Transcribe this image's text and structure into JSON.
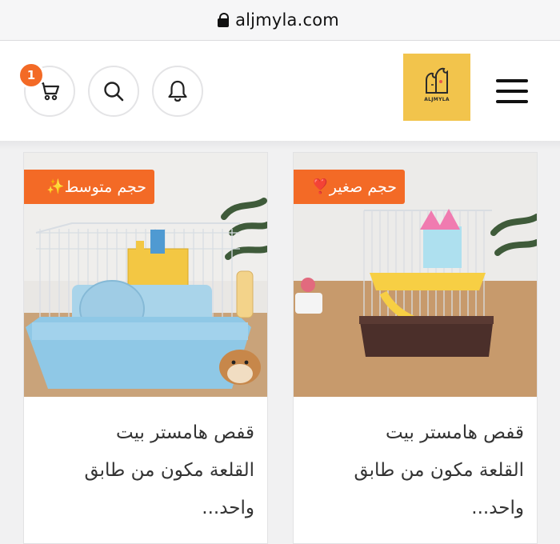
{
  "browser": {
    "url": "aljmyla.com"
  },
  "header": {
    "cart_count": "1",
    "logo_text": "ALJMYLA"
  },
  "products": [
    {
      "badge_label": "حجم متوسط",
      "badge_emoji": "✨",
      "title_lines": [
        "قفص هامستر بيت",
        "القلعة مكون من طابق",
        "واحد..."
      ],
      "image_icon": "hamster-cage-blue-image"
    },
    {
      "badge_label": "حجم صغير",
      "badge_emoji": "❣️",
      "title_lines": [
        "قفص هامستر بيت",
        "القلعة مكون من طابق",
        "واحد..."
      ],
      "image_icon": "hamster-cage-brown-image"
    }
  ],
  "colors": {
    "accent": "#f36a26",
    "logo_bg": "#f2c44c"
  }
}
